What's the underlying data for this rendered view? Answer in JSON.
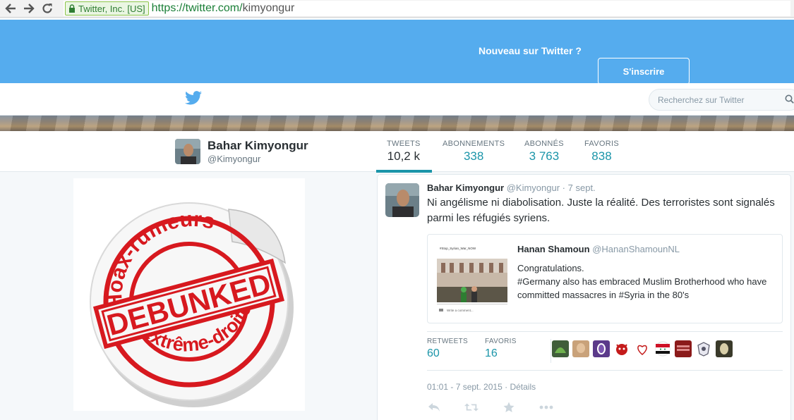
{
  "browser": {
    "cert_label": "Twitter, Inc. [US]",
    "url_scheme_host": "https://twitter.com/",
    "url_path": "kimyongur"
  },
  "signup": {
    "prompt": "Nouveau sur Twitter ?",
    "button": "S'inscrire"
  },
  "search": {
    "placeholder": "Recherchez sur Twitter"
  },
  "profile": {
    "name": "Bahar Kimyongur",
    "handle": "@Kimyongur",
    "stats": [
      {
        "label": "TWEETS",
        "value": "10,2 k"
      },
      {
        "label": "ABONNEMENTS",
        "value": "338"
      },
      {
        "label": "ABONNÉS",
        "value": "3 763"
      },
      {
        "label": "FAVORIS",
        "value": "838"
      }
    ]
  },
  "left_image": {
    "top_text": "Hoax-rumeurs",
    "stamp_text": "DEBUNKED",
    "bottom_text": "d'extrême-droite"
  },
  "tweet": {
    "author_name": "Bahar Kimyongur",
    "author_handle": "@Kimyongur",
    "separator": "·",
    "date": "7 sept.",
    "text": "Ni angélisme ni diabolisation. Juste la réalité. Des terroristes sont signalés parmi les réfugiés syriens.",
    "quote": {
      "author_name": "Hanan Shamoun",
      "author_handle": "@HananShamounNL",
      "text_line1": "Congratulations.",
      "text_line2": "#Germany also has embraced Muslim Brotherhood who have committed massacres in #Syria in the 80's",
      "thumb_hashtag": "#Stop_Syrian_War_NOW",
      "thumb_comment": "Write a comment..."
    },
    "retweets_label": "RETWEETS",
    "retweets_value": "60",
    "favorites_label": "FAVORIS",
    "favorites_value": "16",
    "meta_time": "01:01 - 7 sept. 2015",
    "meta_sep": "·",
    "meta_details": "Détails"
  },
  "colors": {
    "banner_blue": "#55acee",
    "link_teal": "#1b95a9",
    "stamp_red": "#d7191f"
  },
  "icons": [
    "back-icon",
    "forward-icon",
    "reload-icon",
    "lock-icon",
    "twitter-bird-icon",
    "search-icon",
    "reply-icon",
    "retweet-icon",
    "favorite-star-icon",
    "more-icon"
  ]
}
